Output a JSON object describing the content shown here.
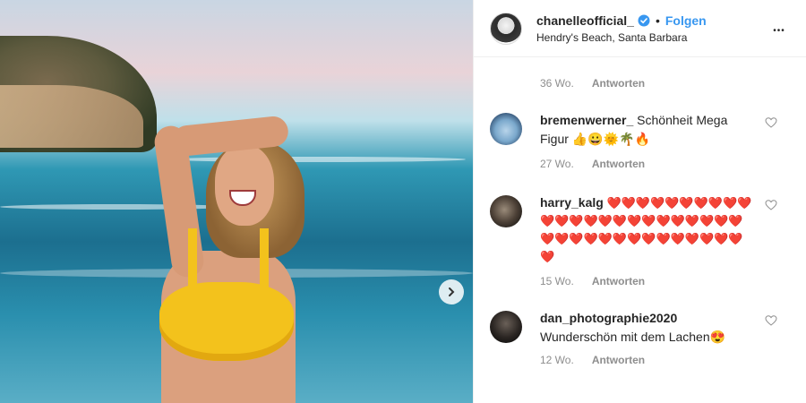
{
  "post": {
    "username": "chanelleofficial_",
    "dot": "•",
    "follow_label": "Folgen",
    "location": "Hendry's Beach, Santa Barbara",
    "more_label": "•••"
  },
  "first_meta": {
    "age": "36 Wo.",
    "reply": "Antworten"
  },
  "comments": [
    {
      "user": "bremenwerner_",
      "text": "Schönheit Mega Figur 👍😀🌞🌴🔥",
      "age": "27 Wo.",
      "reply": "Antworten"
    },
    {
      "user": "harry_kalg",
      "text": "❤️❤️❤️❤️❤️❤️❤️❤️❤️❤️❤️❤️❤️❤️❤️❤️❤️❤️❤️❤️❤️❤️❤️❤️❤️❤️❤️❤️❤️❤️❤️❤️❤️❤️❤️❤️❤️❤️❤️",
      "age": "15 Wo.",
      "reply": "Antworten"
    },
    {
      "user": "dan_photographie2020",
      "text": "Wunderschön mit dem Lachen😍",
      "age": "12 Wo.",
      "reply": "Antworten"
    }
  ],
  "icons": {
    "verified": "verified-badge-icon",
    "heart": "heart-outline-icon",
    "next": "chevron-right-icon",
    "more": "more-horizontal-icon"
  },
  "colors": {
    "accent": "#3897f0",
    "muted": "#8e8e8e",
    "text": "#262626"
  }
}
